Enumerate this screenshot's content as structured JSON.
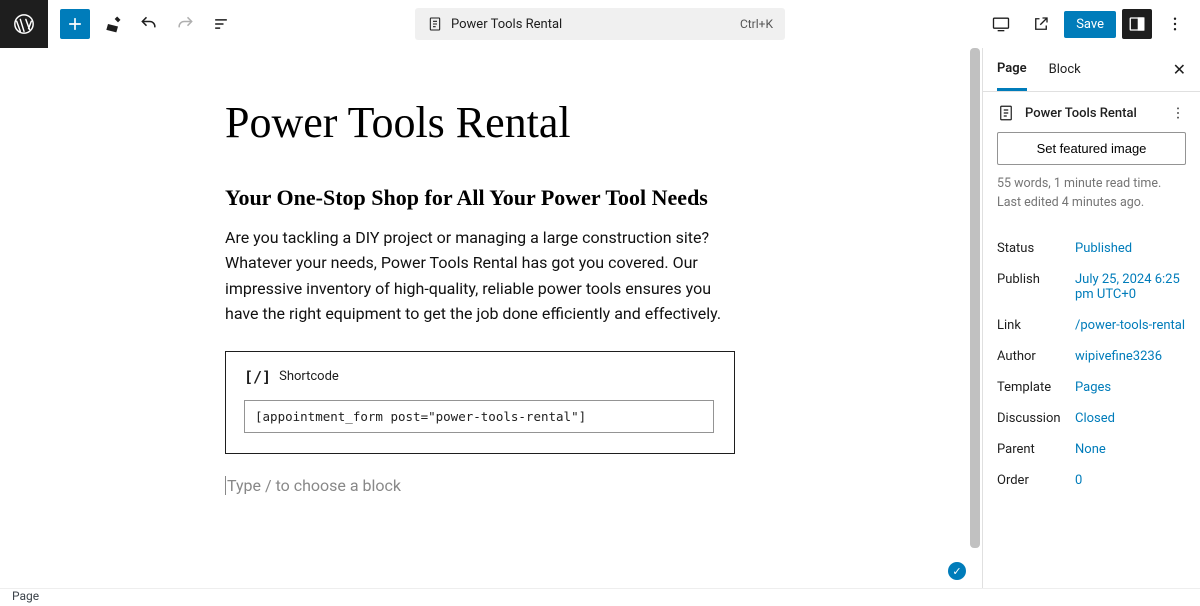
{
  "header": {
    "doc_title": "Power Tools Rental",
    "shortcut": "Ctrl+K",
    "save_label": "Save"
  },
  "content": {
    "title": "Power Tools Rental",
    "subtitle": "Your One-Stop Shop for All Your Power Tool Needs",
    "paragraph": "Are you tackling a DIY project or managing a large construction site? Whatever your needs, Power Tools Rental has got you covered. Our impressive inventory of high-quality, reliable power tools ensures you have the right equipment to get the job done efficiently and effectively.",
    "shortcode_label": "Shortcode",
    "shortcode_value": "[appointment_form post=\"power-tools-rental\"]",
    "placeholder": "Type / to choose a block"
  },
  "sidebar": {
    "tabs": {
      "page": "Page",
      "block": "Block"
    },
    "page_name": "Power Tools Rental",
    "featured_btn": "Set featured image",
    "meta_line1": "55 words, 1 minute read time.",
    "meta_line2": "Last edited 4 minutes ago.",
    "rows": {
      "status": {
        "k": "Status",
        "v": "Published"
      },
      "publish": {
        "k": "Publish",
        "v": "July 25, 2024 6:25 pm UTC+0"
      },
      "link": {
        "k": "Link",
        "v": "/power-tools-rental"
      },
      "author": {
        "k": "Author",
        "v": "wipivefine3236"
      },
      "template": {
        "k": "Template",
        "v": "Pages"
      },
      "discussion": {
        "k": "Discussion",
        "v": "Closed"
      },
      "parent": {
        "k": "Parent",
        "v": "None"
      },
      "order": {
        "k": "Order",
        "v": "0"
      }
    }
  },
  "footer": {
    "breadcrumb": "Page"
  }
}
